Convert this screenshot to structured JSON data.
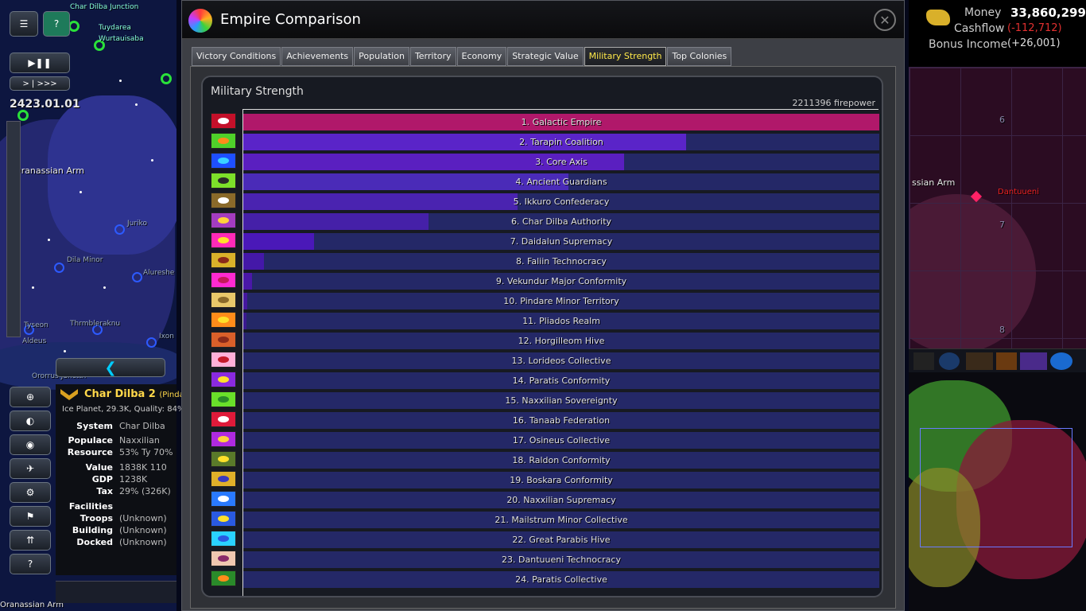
{
  "window": {
    "title": "Empire Comparison",
    "close_label": "✕"
  },
  "tabs": [
    {
      "label": "Victory Conditions"
    },
    {
      "label": "Achievements"
    },
    {
      "label": "Population"
    },
    {
      "label": "Territory"
    },
    {
      "label": "Economy"
    },
    {
      "label": "Strategic Value"
    },
    {
      "label": "Military Strength",
      "active": true
    },
    {
      "label": "Top Colonies"
    }
  ],
  "panel": {
    "title": "Military Strength",
    "max_label": "2211396 firepower"
  },
  "chart_data": {
    "type": "bar",
    "orientation": "horizontal",
    "title": "Military Strength",
    "max_value_label": "2211396 firepower",
    "xlim": [
      0,
      2211396
    ],
    "categories": [
      "1. Galactic Empire",
      "2. Tarapin Coalition",
      "3. Core Axis",
      "4. Ancient Guardians",
      "5. Ikkuro Confederacy",
      "6. Char Dilba Authority",
      "7. Daidalun Supremacy",
      "8. Faliin Technocracy",
      "9. Vekundur Major Conformity",
      "10. Pindare Minor Territory",
      "11. Pliados Realm",
      "12. Horgilleom Hive",
      "13. Lorideos Collective",
      "14. Paratis Conformity",
      "15. Naxxilian Sovereignty",
      "16. Tanaab Federation",
      "17. Osineus Collective",
      "18. Raldon Conformity",
      "19. Boskara Conformity",
      "20. Naxxilian Supremacy",
      "21. Mailstrum Minor Collective",
      "22. Great Parabis Hive",
      "23. Dantuueni Technocracy",
      "24. Paratis Collective"
    ],
    "values": [
      2211396,
      1540000,
      1325000,
      1130000,
      955000,
      645000,
      245000,
      72000,
      30000,
      15000,
      10000,
      5000,
      3000,
      2000,
      1000,
      800,
      600,
      500,
      400,
      300,
      200,
      100,
      50,
      20
    ],
    "bar_colors": [
      "#b0186a",
      "#5a24c8",
      "#5a1fc0",
      "#4a2bb8",
      "#4a23b0",
      "#4520a8",
      "#4a18b8",
      "#4418a8",
      "#4a18a8",
      "#4418a0",
      "#3a1a90",
      "#30207a",
      "#2a2080",
      "#2a2080",
      "#2a2080",
      "#2a2080",
      "#2a2080",
      "#2a2080",
      "#2a2080",
      "#2a2080",
      "#2a2080",
      "#2a2080",
      "#2a2080",
      "#2a2080"
    ],
    "emblems": [
      {
        "bg": "#c4102a",
        "fg": "#fff"
      },
      {
        "bg": "#4fd12a",
        "fg": "#ff8c1a"
      },
      {
        "bg": "#1e4fff",
        "fg": "#3ad2ff"
      },
      {
        "bg": "#7de02a",
        "fg": "#2a2a2a"
      },
      {
        "bg": "#8a6a2a",
        "fg": "#fff"
      },
      {
        "bg": "#a43cc0",
        "fg": "#ffd23a"
      },
      {
        "bg": "#ff2ab8",
        "fg": "#ffe02a"
      },
      {
        "bg": "#d9b22a",
        "fg": "#8a2a1a"
      },
      {
        "bg": "#ff2ad2",
        "fg": "#c41a5a"
      },
      {
        "bg": "#e8c86a",
        "fg": "#8a6a2a"
      },
      {
        "bg": "#ff8c1a",
        "fg": "#ffe02a"
      },
      {
        "bg": "#d9602a",
        "fg": "#8a2a1a"
      },
      {
        "bg": "#ffb0d8",
        "fg": "#c41a2a"
      },
      {
        "bg": "#8a2ae0",
        "fg": "#ffe02a"
      },
      {
        "bg": "#6ae02a",
        "fg": "#2a8a2a"
      },
      {
        "bg": "#e01a3a",
        "fg": "#fff"
      },
      {
        "bg": "#b02ae0",
        "fg": "#ffd23a"
      },
      {
        "bg": "#5a7a2a",
        "fg": "#ffe02a"
      },
      {
        "bg": "#e0b02a",
        "fg": "#3a3ac0"
      },
      {
        "bg": "#2a7aff",
        "fg": "#fff"
      },
      {
        "bg": "#2a5ae0",
        "fg": "#ffe02a"
      },
      {
        "bg": "#2ad2ff",
        "fg": "#2a5ae0"
      },
      {
        "bg": "#f0c8b0",
        "fg": "#8a2a6a"
      },
      {
        "bg": "#2a8a2a",
        "fg": "#ff8c1a"
      }
    ]
  },
  "hud": {
    "date": "2423.01.01",
    "speed_label": "> | >>>",
    "money_label": "Money",
    "money_value": "33,860,299",
    "cashflow_label": "Cashflow",
    "cashflow_value": "(-112,712)",
    "bonus_label": "Bonus Income",
    "bonus_value": "(+26,001)"
  },
  "map": {
    "labels": [
      "Char Dilba Junction",
      "Tuydarea",
      "Wurtauisaba",
      "Oranassian Arm",
      "Dila Minor",
      "Juriko",
      "Alureshe",
      "Tyseon",
      "Thrmbleraknu",
      "Aldeus",
      "Ixon",
      "Ororrus Juncttn",
      "Oranassian Arm"
    ],
    "right_labels": [
      "ssian Arm",
      "Dantuueni",
      "6",
      "7",
      "8"
    ]
  },
  "planet": {
    "name": "Char Dilba 2",
    "name_suffix": "(Pindar",
    "subtitle": "Ice Planet, 29.3K, Quality: 84%",
    "fields": [
      {
        "key": "System",
        "value": "Char Dilba"
      },
      {
        "key": "Populace",
        "value": "Naxxilian"
      },
      {
        "key": "Resource",
        "value": "53%  Ty 70%"
      },
      {
        "key": "Value",
        "value": "1838K  110"
      },
      {
        "key": "GDP",
        "value": "1238K"
      },
      {
        "key": "Tax",
        "value": "29% (326K)"
      },
      {
        "key": "Facilities",
        "value": ""
      },
      {
        "key": "Troops",
        "value": "(Unknown)"
      },
      {
        "key": "Building",
        "value": "(Unknown)"
      },
      {
        "key": "Docked",
        "value": "(Unknown)"
      }
    ]
  }
}
